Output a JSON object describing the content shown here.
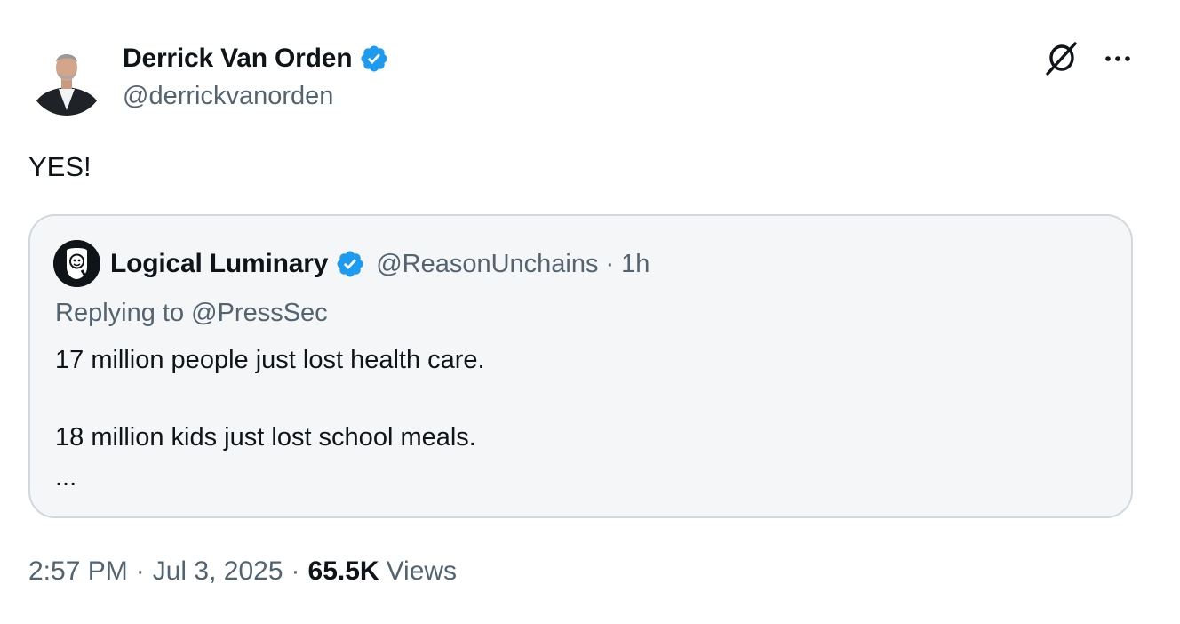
{
  "author": {
    "name": "Derrick Van Orden",
    "handle": "@derrickvanorden",
    "verified": true
  },
  "header_actions": {
    "grok_icon": "grok-icon",
    "more_icon": "more-horizontal-icon"
  },
  "tweet": {
    "text": "YES!"
  },
  "quoted_tweet": {
    "author_name": "Logical Luminary",
    "author_handle": "@ReasonUnchains",
    "separator": "·",
    "time_ago": "1h",
    "replying_to": "Replying to @PressSec",
    "lines": [
      "17 million people just lost health care.",
      "18 million kids just lost school meals."
    ],
    "ellipsis": "..."
  },
  "meta": {
    "time": "2:57 PM",
    "separator": "·",
    "date": "Jul 3, 2025",
    "views_count": "65.5K",
    "views_label": "Views"
  },
  "colors": {
    "primary_text": "#0f1419",
    "secondary_text": "#536471",
    "verified_blue": "#1d9bf0",
    "card_border": "#cfd9de",
    "card_bg": "#f5f6f7"
  }
}
